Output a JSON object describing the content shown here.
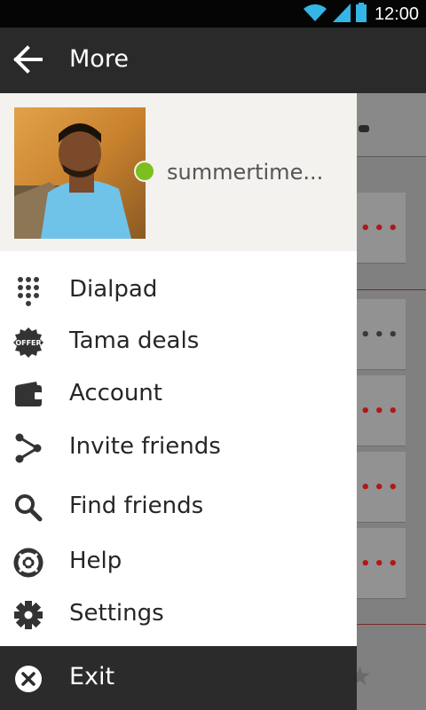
{
  "status_bar": {
    "time": "12:00",
    "icons": [
      "wifi-icon",
      "cell-signal-icon",
      "battery-icon"
    ],
    "accent_color": "#33b5e5"
  },
  "top_bar": {
    "title": "More",
    "back_icon": "back-arrow-icon"
  },
  "profile": {
    "username": "summertime...",
    "presence_color": "#7cbf1e",
    "online": true
  },
  "menu": {
    "items": [
      {
        "label": "Dialpad",
        "icon": "dialpad-icon"
      },
      {
        "label": "Tama deals",
        "icon": "offer-icon",
        "badge_text": "OFFER"
      },
      {
        "label": "Account",
        "icon": "wallet-icon"
      },
      {
        "label": "Invite friends",
        "icon": "share-icon"
      },
      {
        "label": "Find friends",
        "icon": "search-icon"
      },
      {
        "label": "Help",
        "icon": "help-icon"
      },
      {
        "label": "Settings",
        "icon": "gear-icon"
      }
    ]
  },
  "exit": {
    "label": "Exit",
    "icon": "close-circle-icon"
  },
  "colors": {
    "drawer_bg": "#ffffff",
    "profile_bg": "#f4f2ef",
    "bar_bg": "#2a2a2a",
    "text": "#262626",
    "dots_red": "#b01818"
  }
}
